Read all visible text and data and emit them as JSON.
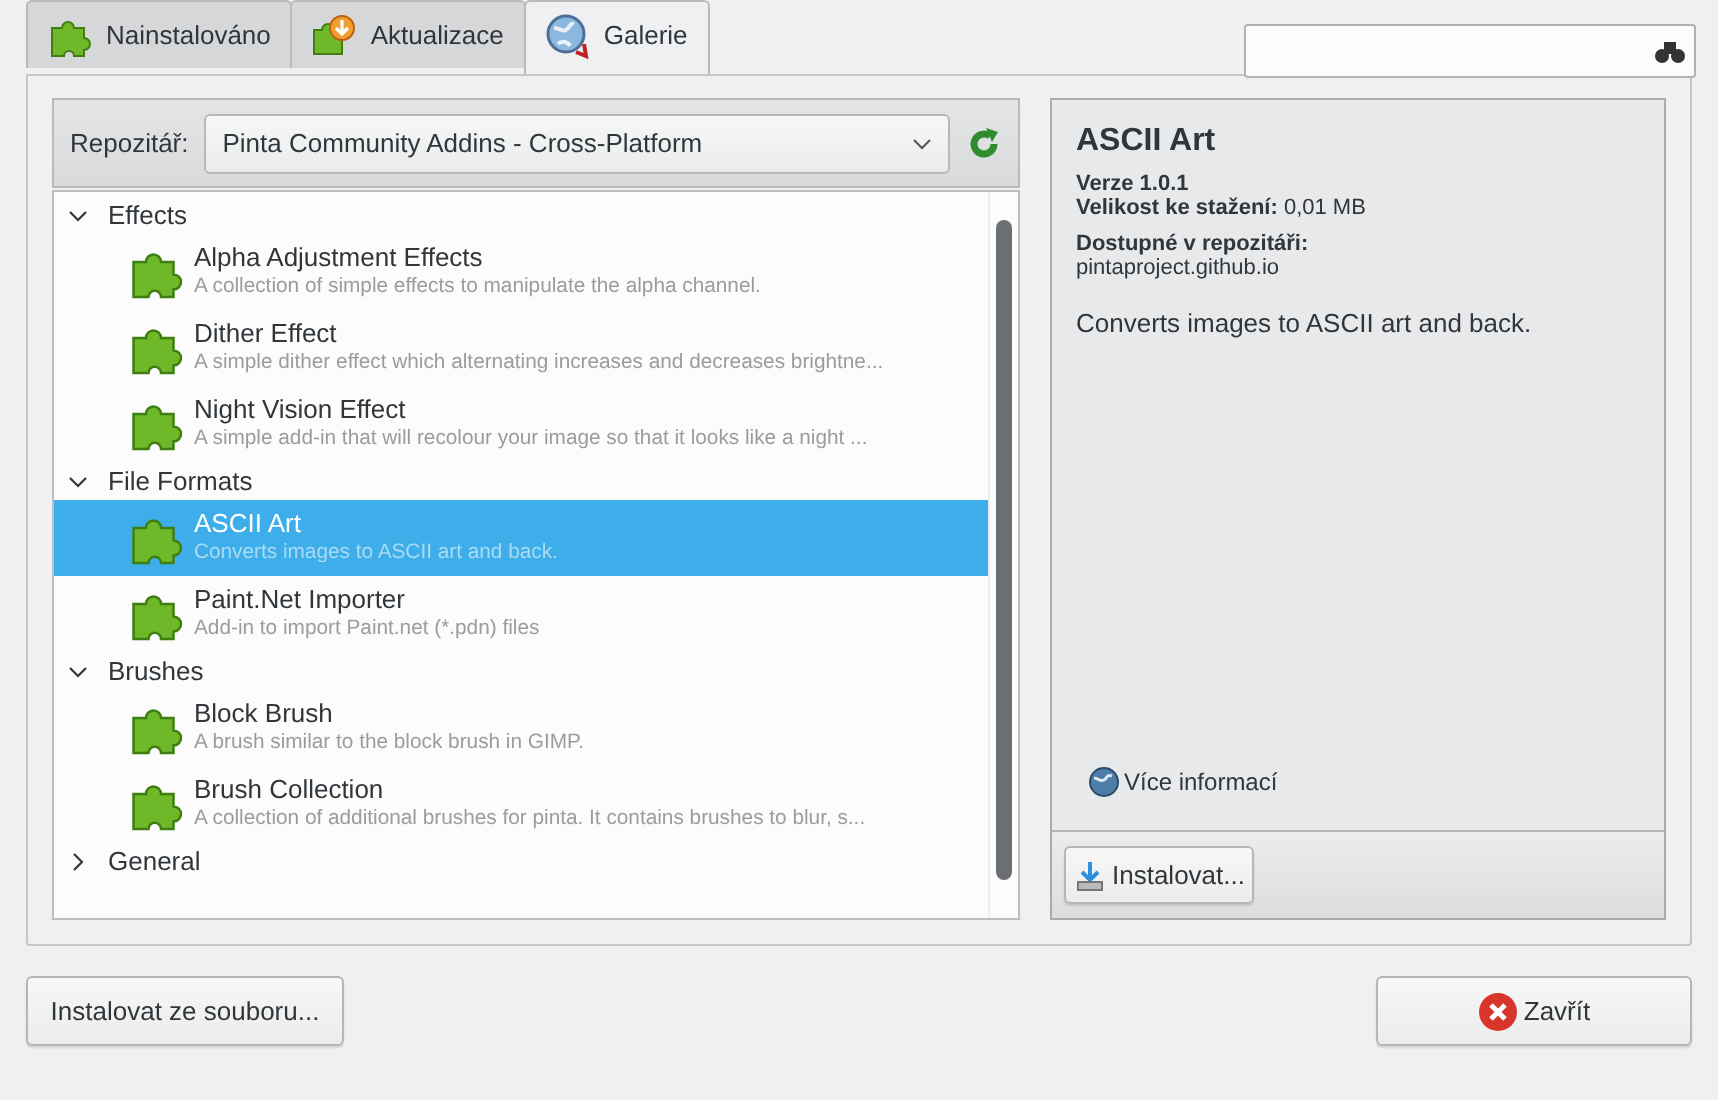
{
  "tabs": [
    {
      "label": "Nainstalováno",
      "selected": false
    },
    {
      "label": "Aktualizace",
      "selected": false
    },
    {
      "label": "Galerie",
      "selected": true
    }
  ],
  "repository": {
    "label": "Repozitář:",
    "value": "Pinta Community Addins - Cross-Platform"
  },
  "tree": [
    {
      "label": "Effects",
      "expanded": true,
      "children": [
        {
          "name": "Alpha Adjustment Effects",
          "description": "A collection of simple effects to manipulate the alpha channel.",
          "selected": false
        },
        {
          "name": "Dither Effect",
          "description": "A simple dither effect which alternating increases and decreases brightne...",
          "selected": false
        },
        {
          "name": "Night Vision Effect",
          "description": "A simple add-in that will recolour your image so that it looks like a night ...",
          "selected": false
        }
      ]
    },
    {
      "label": "File Formats",
      "expanded": true,
      "children": [
        {
          "name": "ASCII Art",
          "description": "Converts images to ASCII art and back.",
          "selected": true
        },
        {
          "name": "Paint.Net Importer",
          "description": "Add-in to import Paint.net (*.pdn) files",
          "selected": false
        }
      ]
    },
    {
      "label": "Brushes",
      "expanded": true,
      "children": [
        {
          "name": "Block Brush",
          "description": "A brush similar to the block brush in GIMP.",
          "selected": false
        },
        {
          "name": "Brush Collection",
          "description": "A collection of additional brushes for pinta. It contains brushes to blur, s...",
          "selected": false
        }
      ]
    },
    {
      "label": "General",
      "expanded": false
    }
  ],
  "details": {
    "title": "ASCII Art",
    "version": "Verze 1.0.1",
    "size_label": "Velikost ke stažení:",
    "size_value": "0,01 MB",
    "repo_label": "Dostupné v repozitáři:",
    "repo_value": "pintaproject.github.io",
    "description": "Converts images to ASCII art and back.",
    "more_info": "Více informací",
    "install": "Instalovat..."
  },
  "buttons": {
    "install_from_file": "Instalovat ze souboru...",
    "close": "Zavřít"
  }
}
